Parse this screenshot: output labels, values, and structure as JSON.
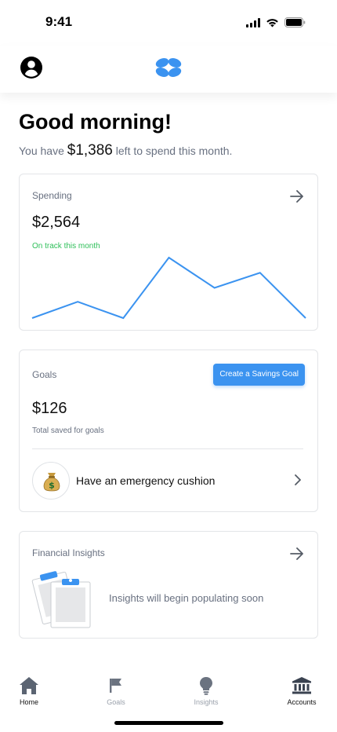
{
  "status_bar": {
    "time": "9:41",
    "icons": [
      "signal-icon",
      "wifi-icon",
      "battery-icon"
    ]
  },
  "header": {
    "profile_icon": "account-circle-icon",
    "logo": "app-logo"
  },
  "greeting": {
    "title": "Good morning!",
    "prefix": "You have",
    "amount": "$1,386",
    "suffix": "left to spend this month."
  },
  "spending": {
    "title": "Spending",
    "amount": "$2,564",
    "status": "On track this month",
    "status_color": "#2ebf59",
    "line_color": "#3b93f0",
    "trend": [
      0.0,
      0.27,
      0.0,
      1.0,
      0.5,
      0.75,
      0.0
    ]
  },
  "goals": {
    "title": "Goals",
    "create_button": "Create a Savings Goal",
    "amount": "$126",
    "caption": "Total saved for goals",
    "item": {
      "icon": "money-bag-icon",
      "icon_glyph": "💰",
      "label": "Have an emergency cushion"
    }
  },
  "insights": {
    "title": "Financial Insights",
    "message": "Insights will begin populating soon"
  },
  "tabs": [
    {
      "label": "Home",
      "icon": "home-icon",
      "active": true
    },
    {
      "label": "Goals",
      "icon": "flag-icon",
      "active": false
    },
    {
      "label": "Insights",
      "icon": "lightbulb-icon",
      "active": false
    },
    {
      "label": "Accounts",
      "icon": "bank-icon",
      "active": false
    }
  ],
  "colors": {
    "accent": "#3b93f0",
    "muted_text": "#687080",
    "border": "#e3e5e8"
  }
}
